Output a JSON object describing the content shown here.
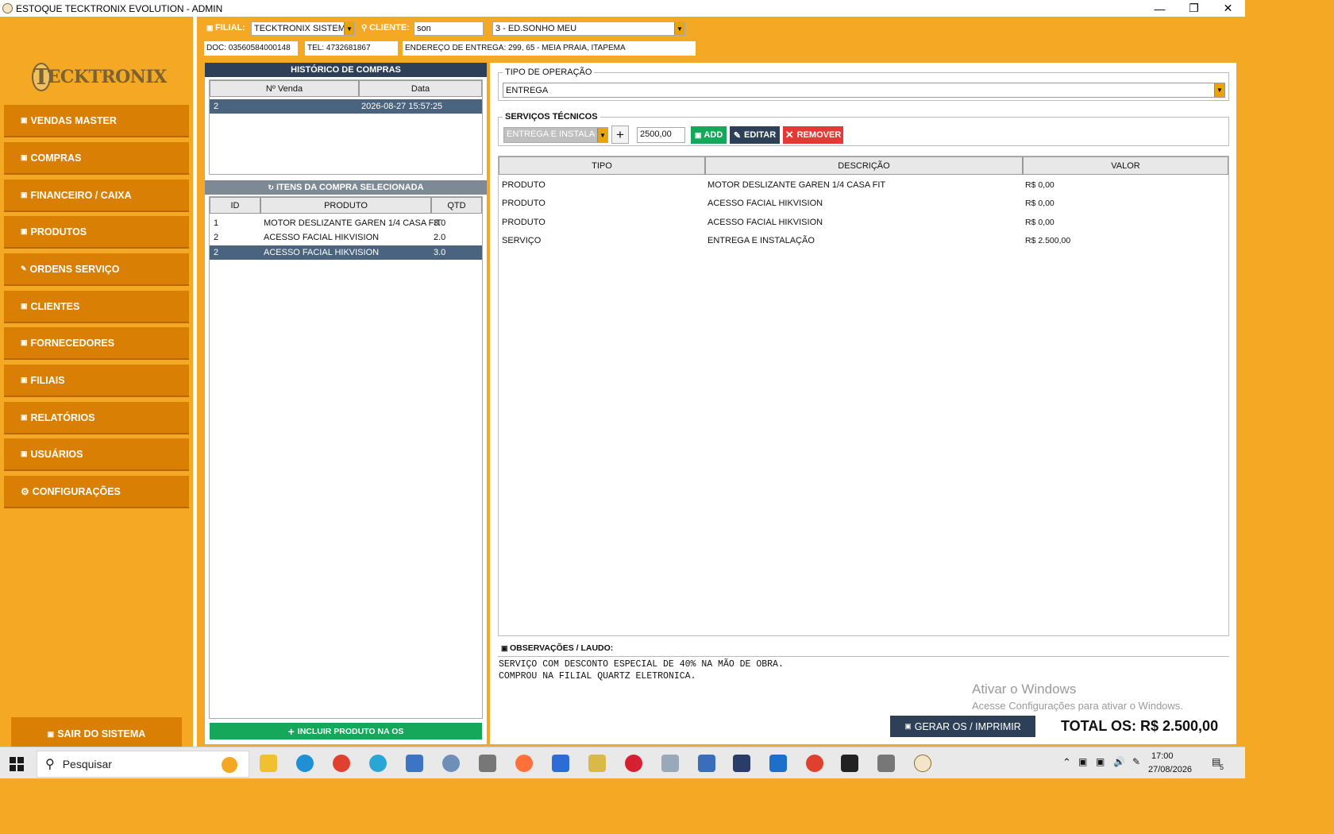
{
  "window": {
    "title": "ESTOQUE TECKTRONIX EVOLUTION - ADMIN",
    "controls": [
      "—",
      "❐",
      "✕"
    ]
  },
  "sidebar": {
    "logo_text": "ECKTRONIX",
    "logo_initial": "T",
    "items": [
      {
        "label": "VENDAS MASTER",
        "icon": "cart-icon"
      },
      {
        "label": "COMPRAS",
        "icon": "box-icon"
      },
      {
        "label": "FINANCEIRO / CAIXA",
        "icon": "money-icon"
      },
      {
        "label": "PRODUTOS",
        "icon": "package-icon"
      },
      {
        "label": "ORDENS SERVIÇO",
        "icon": "wrench-icon"
      },
      {
        "label": "CLIENTES",
        "icon": "users-icon"
      },
      {
        "label": "FORNECEDORES",
        "icon": "truck-icon"
      },
      {
        "label": "FILIAIS",
        "icon": "building-icon"
      },
      {
        "label": "RELATÓRIOS",
        "icon": "report-icon"
      },
      {
        "label": "USUÁRIOS",
        "icon": "user-icon"
      },
      {
        "label": "CONFIGURAÇÕES",
        "icon": "gear-icon"
      }
    ],
    "exit_label": "SAIR DO SISTEMA"
  },
  "topbar": {
    "filial_label": "FILIAL:",
    "filial_value": "TECKTRONIX SISTEMAS",
    "cliente_label": "CLIENTE:",
    "cliente_search": "son",
    "cliente_value": "3 - ED.SONHO MEU",
    "doc": "DOC: 03560584000148",
    "tel": "TEL: 4732681867",
    "endereco": "ENDEREÇO DE ENTREGA: 299, 65 - MEIA PRAIA, ITAPEMA"
  },
  "historico": {
    "title": "HISTÓRICO DE COMPRAS",
    "columns": [
      "Nº Venda",
      "Data"
    ],
    "rows": [
      {
        "venda": "2",
        "data": "2026-08-27 15:57:25",
        "selected": true
      }
    ]
  },
  "itens": {
    "title": "ITENS DA COMPRA SELECIONADA",
    "columns": [
      "ID",
      "PRODUTO",
      "QTD"
    ],
    "rows": [
      {
        "id": "1",
        "produto": "MOTOR DESLIZANTE GAREN 1/4 CASA FIT",
        "qtd": "3.0",
        "selected": false
      },
      {
        "id": "2",
        "produto": "ACESSO FACIAL HIKVISION",
        "qtd": "2.0",
        "selected": false
      },
      {
        "id": "2",
        "produto": "ACESSO FACIAL HIKVISION",
        "qtd": "3.0",
        "selected": true
      }
    ],
    "incluir_label": "INCLUIR PRODUTO NA OS"
  },
  "operacao": {
    "legend": "TIPO DE OPERAÇÃO",
    "value": "ENTREGA"
  },
  "servicos": {
    "legend": "SERVIÇOS TÉCNICOS",
    "selected": "ENTREGA E INSTALAÇÃO",
    "plus": "+",
    "valor": "2500,00",
    "add_label": "ADD",
    "editar_label": "EDITAR",
    "remover_label": "REMOVER"
  },
  "main_table": {
    "columns": [
      "TIPO",
      "DESCRIÇÃO",
      "VALOR"
    ],
    "rows": [
      {
        "tipo": "PRODUTO",
        "descricao": "MOTOR DESLIZANTE GAREN 1/4 CASA FIT",
        "valor": "R$ 0,00"
      },
      {
        "tipo": "PRODUTO",
        "descricao": "ACESSO FACIAL HIKVISION",
        "valor": "R$ 0,00"
      },
      {
        "tipo": "PRODUTO",
        "descricao": "ACESSO FACIAL HIKVISION",
        "valor": "R$ 0,00"
      },
      {
        "tipo": "SERVIÇO",
        "descricao": "ENTREGA E INSTALAÇÃO",
        "valor": "R$ 2.500,00"
      }
    ]
  },
  "observacoes": {
    "label": "OBSERVAÇÕES / LAUDO:",
    "text": "SERVIÇO COM DESCONTO ESPECIAL DE 40% NA MÃO DE OBRA.\nCOMPROU NA FILIAL QUARTZ ELETRONICA."
  },
  "watermark": {
    "line1": "Ativar o Windows",
    "line2": "Acesse Configurações para ativar o Windows."
  },
  "footer": {
    "gerar_label": "GERAR OS / IMPRIMIR",
    "total": "TOTAL OS: R$ 2.500,00"
  },
  "taskbar": {
    "search_placeholder": "Pesquisar",
    "time": "17:00",
    "date": "27/08/2026",
    "notif_count": "5"
  },
  "colors": {
    "accent": "#f5a823",
    "menu": "#d97f04",
    "selection": "#4a6480",
    "header_dark": "#2e4057",
    "green": "#16a85a",
    "red": "#e53935"
  }
}
